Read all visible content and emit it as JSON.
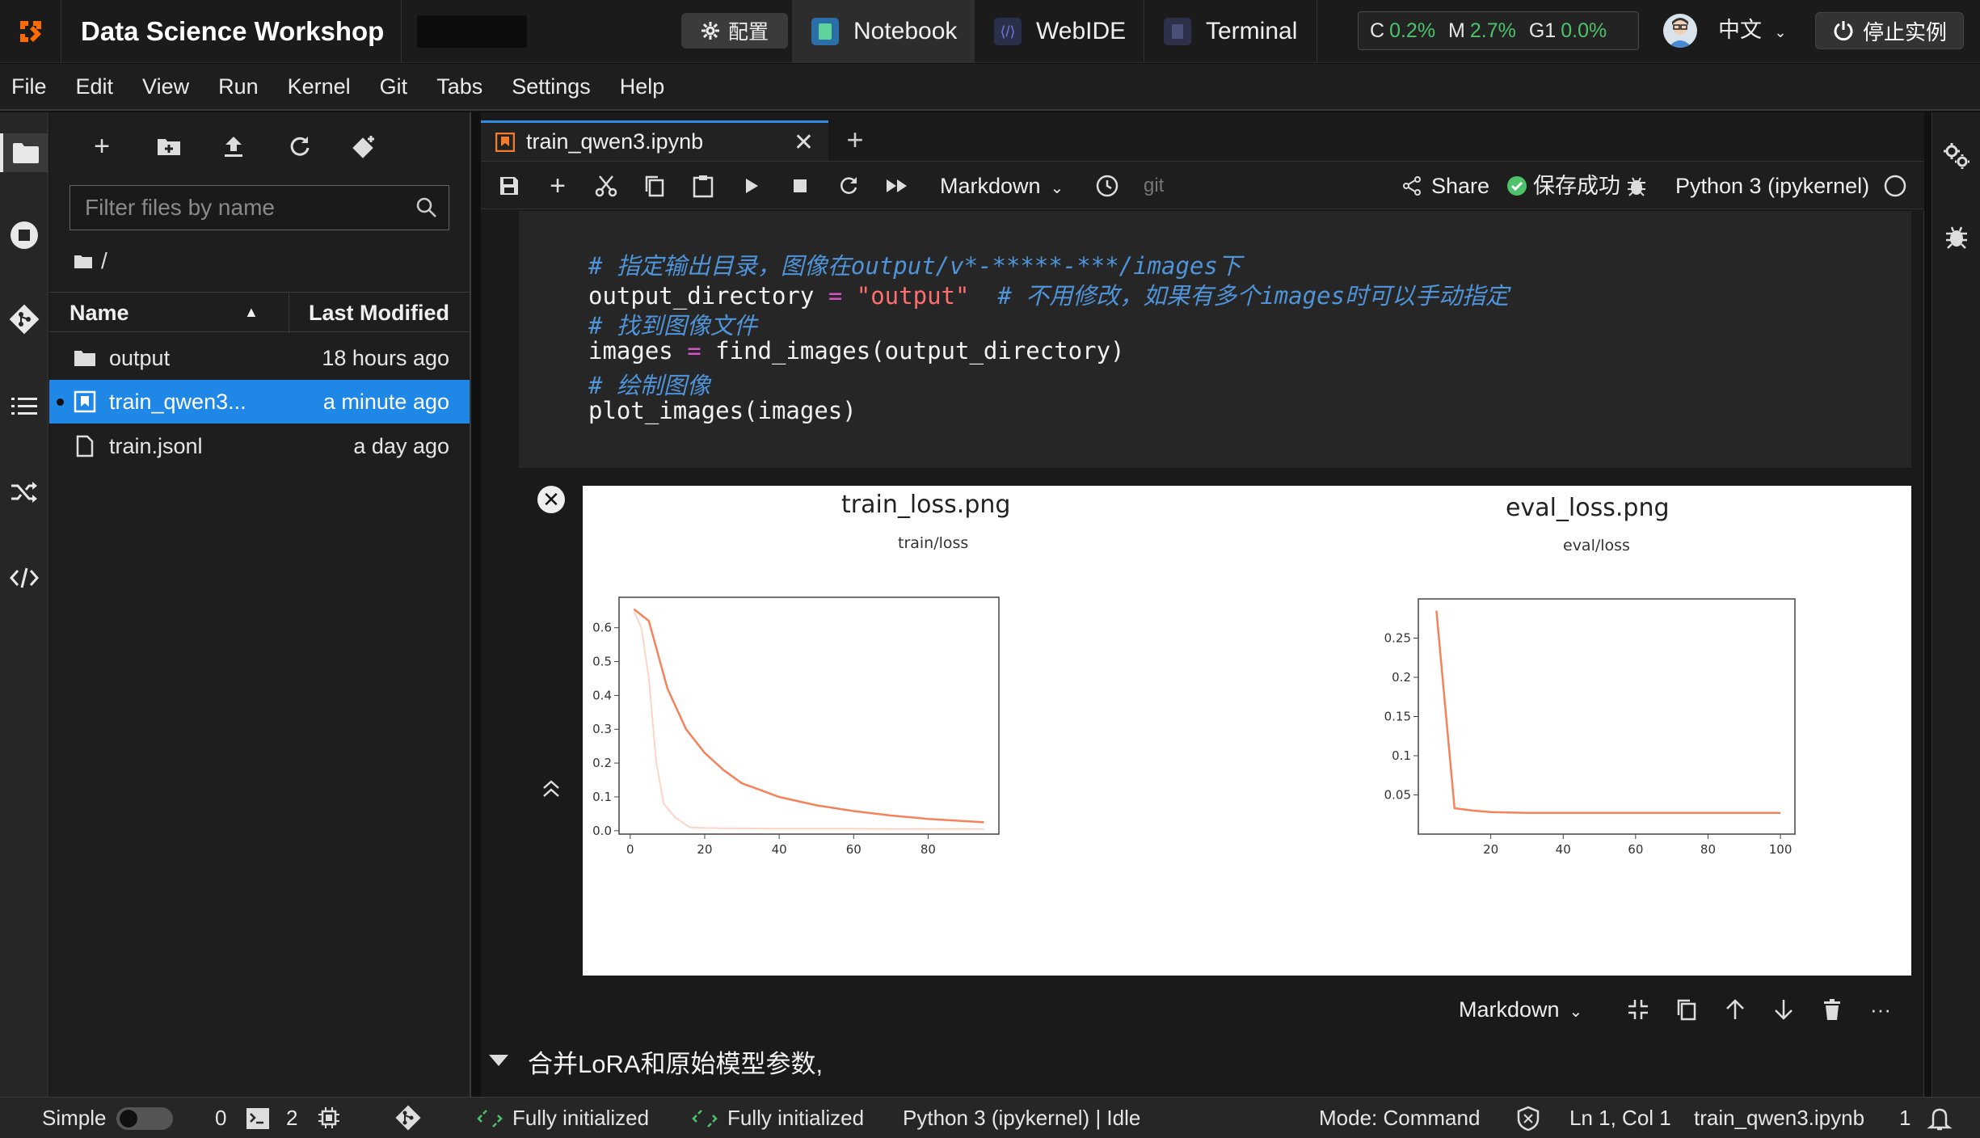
{
  "topbar": {
    "app_title": "Data Science Workshop",
    "config_label": "配置",
    "tabs": [
      {
        "label": "Notebook",
        "icon": "notebook-icon"
      },
      {
        "label": "WebIDE",
        "icon": "webide-icon"
      },
      {
        "label": "Terminal",
        "icon": "terminal-icon"
      }
    ],
    "resources": {
      "cpu_label": "C",
      "cpu": "0.2%",
      "mem_label": "M",
      "mem": "2.7%",
      "gpu_label": "G1",
      "gpu": "0.0%"
    },
    "language": "中文",
    "stop_label": "停止实例"
  },
  "menubar": [
    "File",
    "Edit",
    "View",
    "Run",
    "Kernel",
    "Git",
    "Tabs",
    "Settings",
    "Help"
  ],
  "filebrowser": {
    "filter_placeholder": "Filter files by name",
    "breadcrumb": "/",
    "col_name": "Name",
    "col_modified": "Last Modified",
    "files": [
      {
        "name": "output",
        "modified": "18 hours ago",
        "type": "folder"
      },
      {
        "name": "train_qwen3...",
        "modified": "a minute ago",
        "type": "notebook"
      },
      {
        "name": "train.jsonl",
        "modified": "a day ago",
        "type": "file"
      }
    ]
  },
  "notebook": {
    "tab_label": "train_qwen3.ipynb",
    "cell_type": "Markdown",
    "git_label": "git",
    "share_label": "Share",
    "save_status": "保存成功",
    "kernel_name": "Python 3 (ipykernel)",
    "code": {
      "comment1": "# 指定输出目录，图像在output/v*-*****-***/images下",
      "line2_var": "output_directory",
      "line2_op": "=",
      "line2_str": "\"output\"",
      "line2_comment": "# 不用修改，如果有多个images时可以手动指定",
      "comment3": "# 找到图像文件",
      "line4_var": "images",
      "line4_op": "=",
      "line4_call": "find_images(output_directory)",
      "comment5": "# 绘制图像",
      "line6": "plot_images(images)"
    },
    "cell_toolbar_type": "Markdown",
    "markdown_text": "合并LoRA和原始模型参数,"
  },
  "chart_data": [
    {
      "type": "line",
      "title": "train_loss.png",
      "subtitle": "train/loss",
      "xlim": [
        -3,
        99
      ],
      "ylim": [
        -0.01,
        0.69
      ],
      "xticks": [
        0,
        20,
        40,
        60,
        80
      ],
      "yticks": [
        0.0,
        0.1,
        0.2,
        0.3,
        0.4,
        0.5,
        0.6
      ],
      "series": [
        {
          "role": "raw",
          "x": [
            1,
            3,
            5,
            7,
            9,
            12,
            16,
            20,
            30,
            40,
            50,
            60,
            70,
            80,
            95
          ],
          "y": [
            0.65,
            0.6,
            0.45,
            0.2,
            0.08,
            0.04,
            0.01,
            0.008,
            0.007,
            0.006,
            0.006,
            0.006,
            0.005,
            0.005,
            0.005
          ]
        },
        {
          "role": "smoothed",
          "x": [
            1,
            5,
            10,
            15,
            20,
            25,
            30,
            35,
            40,
            50,
            60,
            70,
            80,
            95
          ],
          "y": [
            0.655,
            0.62,
            0.42,
            0.3,
            0.23,
            0.18,
            0.14,
            0.12,
            0.1,
            0.075,
            0.058,
            0.045,
            0.035,
            0.025
          ]
        }
      ]
    },
    {
      "type": "line",
      "title": "eval_loss.png",
      "subtitle": "eval/loss",
      "xlim": [
        0,
        104
      ],
      "ylim": [
        0.0,
        0.3
      ],
      "xticks": [
        20,
        40,
        60,
        80,
        100
      ],
      "yticks": [
        0.05,
        0.1,
        0.15,
        0.2,
        0.25
      ],
      "series": [
        {
          "role": "smoothed",
          "x": [
            5,
            10,
            15,
            20,
            30,
            40,
            50,
            60,
            70,
            80,
            90,
            100
          ],
          "y": [
            0.285,
            0.033,
            0.03,
            0.028,
            0.027,
            0.027,
            0.027,
            0.027,
            0.027,
            0.027,
            0.027,
            0.027
          ]
        }
      ]
    }
  ],
  "statusbar": {
    "mode_simple": "Simple",
    "terminals": "0",
    "kernels": "2",
    "init1": "Fully initialized",
    "init2": "Fully initialized",
    "kernel_status": "Python 3 (ipykernel) | Idle",
    "mode": "Mode: Command",
    "cursor": "Ln 1, Col 1",
    "file": "train_qwen3.ipynb",
    "notifications": "1"
  },
  "colors": {
    "accent": "#1f87e6",
    "plot_line": "#f5825a",
    "plot_raw": "#fcd5c6",
    "ok_green": "#4cc36a"
  }
}
